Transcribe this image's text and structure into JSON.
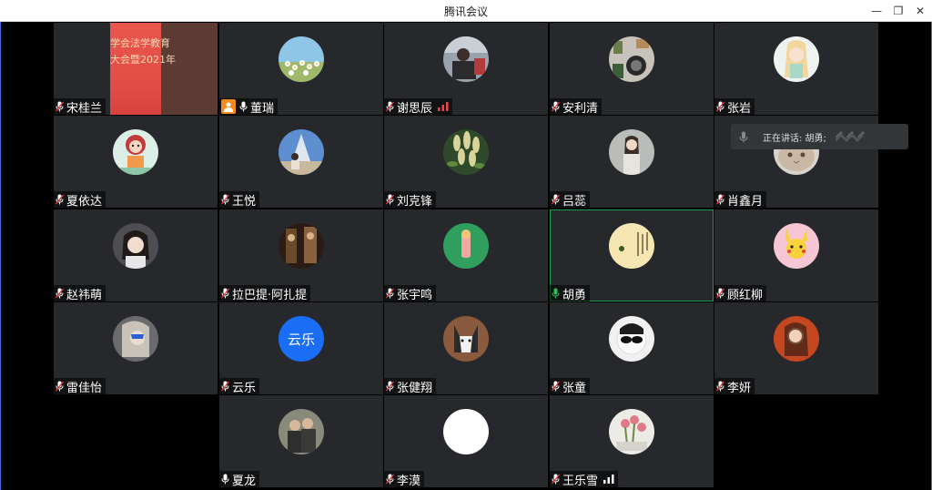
{
  "window": {
    "title": "腾讯会议"
  },
  "speaking_popup": {
    "label": "正在讲话: 胡勇;"
  },
  "colors": {
    "tile_bg": "#26282b",
    "host_badge": "#f38a1f",
    "speaking_border": "#1c9c4a",
    "active_mic": "#2ac15a",
    "avatar_text_bg": "#1a6ef5"
  },
  "participants": [
    {
      "name": "宋桂兰",
      "mic": "muted",
      "avatar": "screen-share"
    },
    {
      "name": "董瑞",
      "mic": "on",
      "host": true,
      "avatar": "daisies"
    },
    {
      "name": "谢思辰",
      "mic": "muted",
      "signal": true,
      "avatar": "photo"
    },
    {
      "name": "安利清",
      "mic": "muted",
      "avatar": "photo"
    },
    {
      "name": "张岩",
      "mic": "muted",
      "avatar": "illustration"
    },
    {
      "name": "夏依达",
      "mic": "muted",
      "avatar": "cartoon-monkey"
    },
    {
      "name": "王悦",
      "mic": "muted",
      "avatar": "photo"
    },
    {
      "name": "刘克锋",
      "mic": "muted",
      "avatar": "plant"
    },
    {
      "name": "吕蕊",
      "mic": "muted",
      "avatar": "photo"
    },
    {
      "name": "肖鑫月",
      "mic": "muted",
      "avatar": "cat"
    },
    {
      "name": "赵祎萌",
      "mic": "muted",
      "avatar": "photo"
    },
    {
      "name": "拉巴提·阿扎提",
      "mic": "muted",
      "avatar": "photo"
    },
    {
      "name": "张宇鸣",
      "mic": "muted",
      "avatar": "figure"
    },
    {
      "name": "胡勇",
      "mic": "active",
      "speaking": true,
      "avatar": "calligraphy"
    },
    {
      "name": "顾红柳",
      "mic": "muted",
      "avatar": "pikachu"
    },
    {
      "name": "雷佳怡",
      "mic": "muted",
      "avatar": "photo"
    },
    {
      "name": "云乐",
      "mic": "muted",
      "avatar_text": "云乐"
    },
    {
      "name": "张健翔",
      "mic": "muted",
      "avatar": "dog"
    },
    {
      "name": "张童",
      "mic": "muted",
      "avatar": "sunglasses"
    },
    {
      "name": "李妍",
      "mic": "muted",
      "avatar": "photo"
    },
    {
      "name": "夏龙",
      "mic": "on",
      "avatar": "photo"
    },
    {
      "name": "李漠",
      "mic": "muted",
      "avatar": "blank"
    },
    {
      "name": "王乐雪",
      "mic": "muted",
      "signal": true,
      "avatar": "flowers"
    }
  ],
  "slide": {
    "line1": "学会法学教育",
    "line2": "大会暨2021年"
  }
}
